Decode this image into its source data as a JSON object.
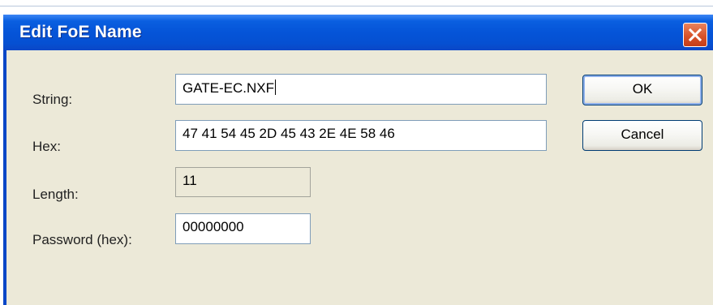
{
  "window": {
    "title": "Edit FoE Name",
    "close_icon": "close-icon"
  },
  "form": {
    "string_label": "String:",
    "string_value": "GATE-EC.NXF",
    "hex_label": "Hex:",
    "hex_value": "47 41 54 45 2D 45 43 2E 4E 58 46",
    "length_label": "Length:",
    "length_value": "11",
    "password_label": "Password (hex):",
    "password_value": "00000000"
  },
  "buttons": {
    "ok_label": "OK",
    "cancel_label": "Cancel"
  },
  "colors": {
    "titlebar": "#0554d8",
    "dialog_bg": "#ece9d8",
    "close_button": "#d8532a"
  }
}
